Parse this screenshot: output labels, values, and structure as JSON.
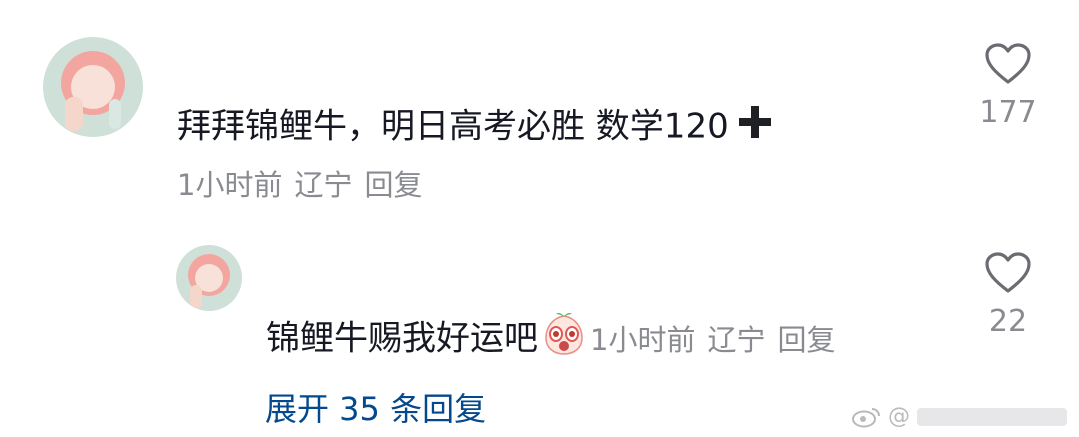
{
  "comment": {
    "avatar_icon": "user-avatar",
    "text": "拜拜锦鲤牛，明日高考必胜 数学120",
    "trailing_icon": "plus-icon",
    "time": "1小时前",
    "location": "辽宁",
    "reply_label": "回复",
    "like_icon": "heart-outline-icon",
    "like_count": "177"
  },
  "reply": {
    "avatar_icon": "user-avatar",
    "text": "锦鲤牛赐我好运吧",
    "emoji_icon": "surprised-face-emoji",
    "time": "1小时前",
    "location": "辽宁",
    "reply_label": "回复",
    "like_icon": "heart-outline-icon",
    "like_count": "22"
  },
  "expand_label": "展开 35 条回复",
  "watermark": {
    "icon": "weibo-logo-icon",
    "text": "@"
  },
  "colors": {
    "text": "#161823",
    "meta": "#8a8b91",
    "link": "#04498d"
  }
}
